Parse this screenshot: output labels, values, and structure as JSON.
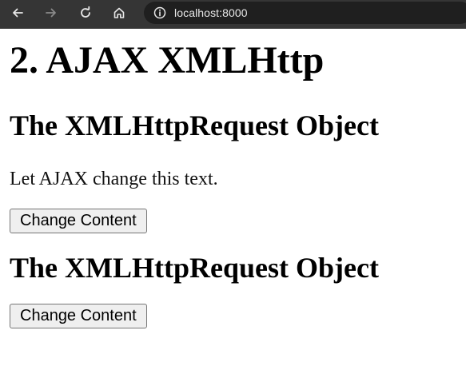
{
  "browser": {
    "url": "localhost:8000",
    "toolbar_color": "#353535",
    "icons": [
      "back-arrow-icon",
      "forward-arrow-icon",
      "reload-icon",
      "home-icon",
      "info-icon"
    ]
  },
  "page": {
    "title": "2. AJAX XMLHttp",
    "sections": [
      {
        "heading": "The XMLHttpRequest Object",
        "text": "Let AJAX change this text.",
        "button_label": "Change Content"
      },
      {
        "heading": "The XMLHttpRequest Object",
        "button_label": "Change Content"
      }
    ]
  }
}
